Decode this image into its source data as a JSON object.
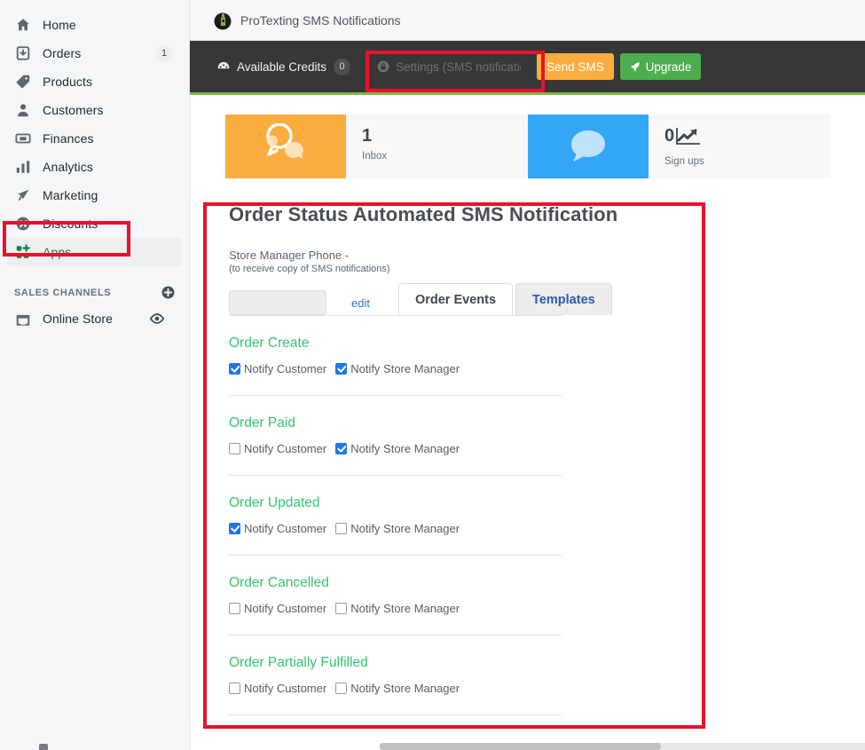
{
  "sidebar": {
    "items": [
      {
        "label": "Home",
        "icon": "home-icon",
        "badge": ""
      },
      {
        "label": "Orders",
        "icon": "orders-icon",
        "badge": "1"
      },
      {
        "label": "Products",
        "icon": "products-icon",
        "badge": ""
      },
      {
        "label": "Customers",
        "icon": "customers-icon",
        "badge": ""
      },
      {
        "label": "Finances",
        "icon": "finances-icon",
        "badge": ""
      },
      {
        "label": "Analytics",
        "icon": "analytics-icon",
        "badge": ""
      },
      {
        "label": "Marketing",
        "icon": "marketing-icon",
        "badge": ""
      },
      {
        "label": "Discounts",
        "icon": "discounts-icon",
        "badge": ""
      },
      {
        "label": "Apps",
        "icon": "apps-icon",
        "badge": ""
      }
    ],
    "section_title": "SALES CHANNELS",
    "add_channel_icon": "plus-circle-icon",
    "channels": [
      {
        "label": "Online Store",
        "icon": "storefront-icon",
        "action_icon": "eye-icon"
      }
    ]
  },
  "app_header": {
    "logo_icon": "protexting-logo-icon",
    "title": "ProTexting SMS Notifications"
  },
  "toolbar": {
    "credits_icon": "speedometer-icon",
    "credits_label": "Available Credits",
    "credits_value": "0",
    "settings_icon": "lock-icon",
    "settings_label": "Settings (SMS notifications)",
    "send_sms_label": "Send SMS",
    "upgrade_icon": "rocket-icon",
    "upgrade_label": "Upgrade",
    "accent_green": "#7fb842",
    "bar_color": "#373737"
  },
  "stats": [
    {
      "icon": "chat-bubbles-icon",
      "tile_color": "#fbad3f",
      "value": "1",
      "caption": "Inbox",
      "value_icon": ""
    },
    {
      "icon": "chat-bubble-icon",
      "tile_color": "#33a7f5",
      "value": "0",
      "caption": "Sign ups",
      "value_icon": "trend-up-icon"
    }
  ],
  "panel": {
    "title": "Order Status Automated SMS Notification",
    "phone_label": "Store Manager Phone -",
    "phone_sublabel": "(to receive copy of SMS notifications)",
    "phone_value": "",
    "edit_label": "edit",
    "tabs": [
      {
        "label": "Order Events",
        "active": true
      },
      {
        "label": "Templates",
        "active": false
      }
    ],
    "notify_customer_label": "Notify Customer",
    "notify_manager_label": "Notify Store Manager",
    "events": [
      {
        "name": "Order Create",
        "notify_customer": true,
        "notify_manager": true
      },
      {
        "name": "Order Paid",
        "notify_customer": false,
        "notify_manager": true
      },
      {
        "name": "Order Updated",
        "notify_customer": true,
        "notify_manager": false
      },
      {
        "name": "Order Cancelled",
        "notify_customer": false,
        "notify_manager": false
      },
      {
        "name": "Order Partially Fulfilled",
        "notify_customer": false,
        "notify_manager": false
      }
    ]
  },
  "highlights": {
    "color": "#e8112d",
    "boxes": [
      "apps-sidebar-item",
      "settings-button",
      "order-status-panel"
    ]
  }
}
